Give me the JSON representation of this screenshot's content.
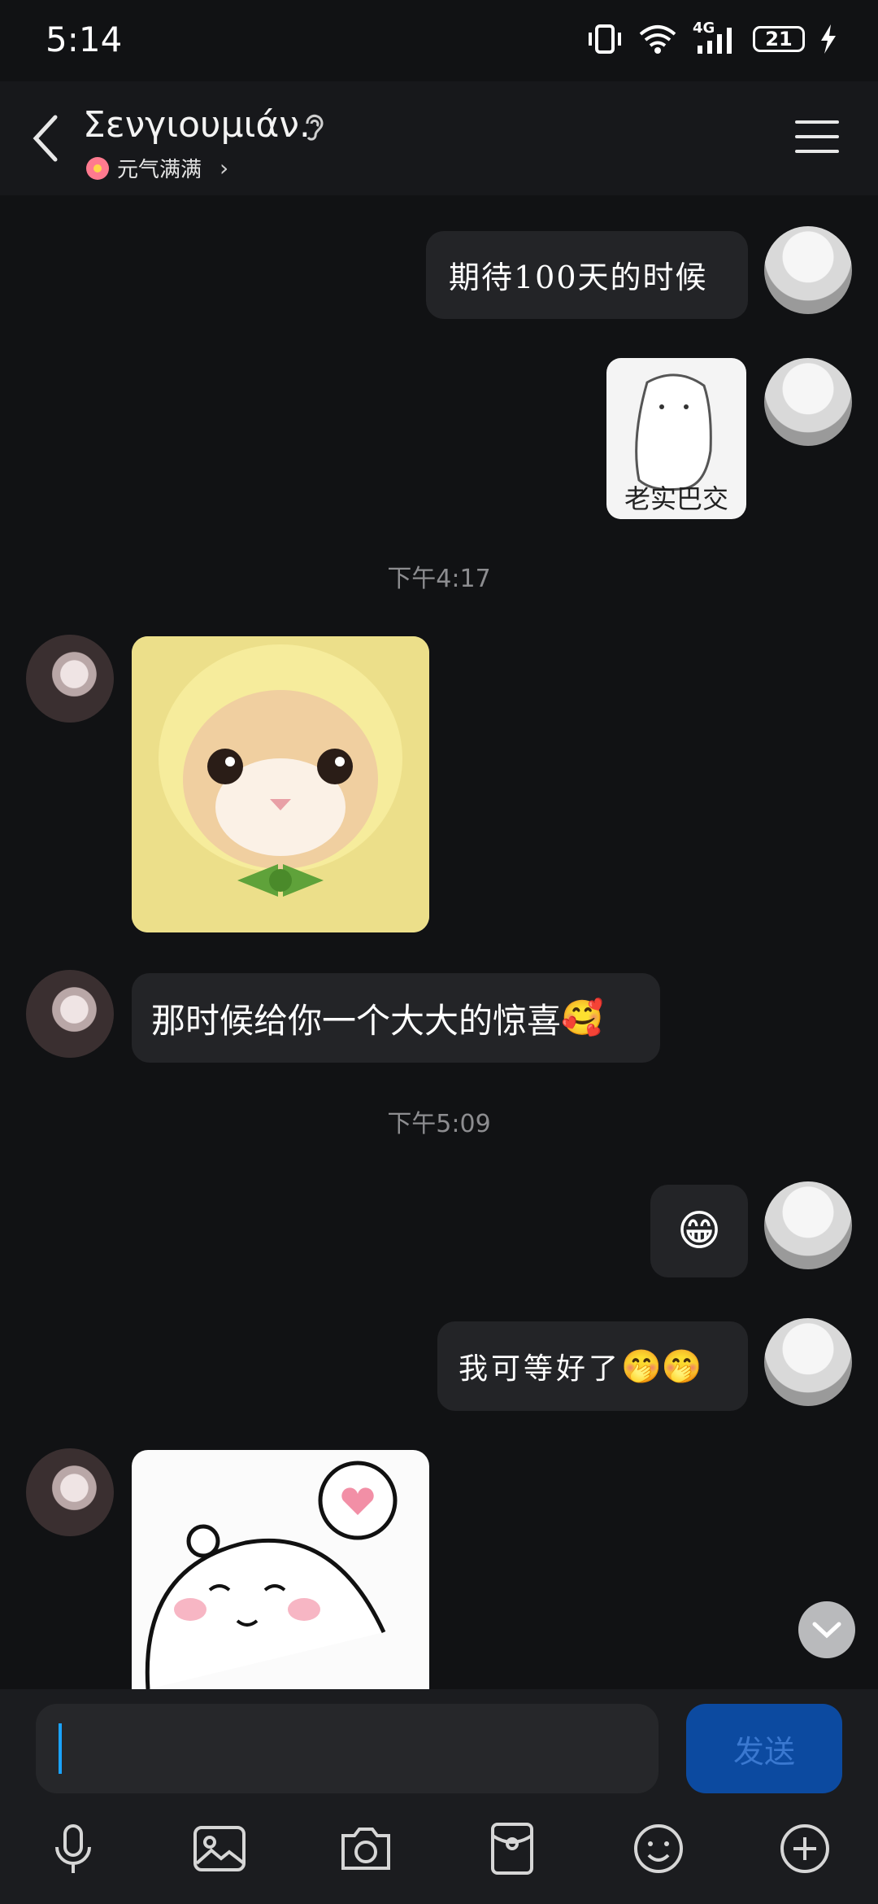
{
  "status_bar": {
    "time": "5:14",
    "battery": "21",
    "network": "4G"
  },
  "header": {
    "title": "Σενγιουμιάν.",
    "subtitle": "元气满满"
  },
  "messages": {
    "m1": "期待100天的时候",
    "sticker_caption": "老实巴交",
    "ts1": "下午4:17",
    "m2": "那时候给你一个大大的惊喜",
    "m2_emoji": "🥰",
    "ts2": "下午5:09",
    "m3_emoji": "😁",
    "m4": "我可等好了",
    "m4_emoji": "🤭🤭"
  },
  "composer": {
    "send_label": "发送",
    "input_value": ""
  },
  "icons": [
    "back-icon",
    "ear-icon",
    "menu-icon",
    "mic-icon",
    "image-icon",
    "camera-icon",
    "red-packet-icon",
    "emoji-icon",
    "plus-icon",
    "chevron-down-icon"
  ]
}
